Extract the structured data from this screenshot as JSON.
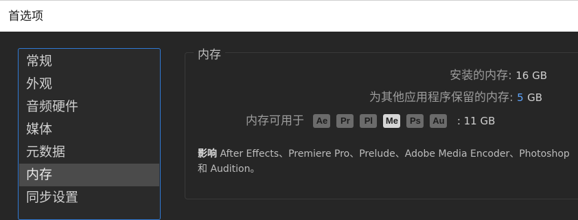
{
  "window": {
    "title": "首选项"
  },
  "sidebar": {
    "items": [
      {
        "label": "常规"
      },
      {
        "label": "外观"
      },
      {
        "label": "音频硬件"
      },
      {
        "label": "媒体"
      },
      {
        "label": "元数据"
      },
      {
        "label": "内存",
        "selected": true
      },
      {
        "label": "同步设置"
      }
    ]
  },
  "memory": {
    "section_title": "内存",
    "installed_label": "安装的内存:",
    "installed_value": "16 GB",
    "reserved_label": "为其他应用程序保留的内存:",
    "reserved_value": "5",
    "reserved_unit": "GB",
    "available_label": "内存可用于",
    "apps": [
      {
        "abbr": "Ae",
        "active": false
      },
      {
        "abbr": "Pr",
        "active": false
      },
      {
        "abbr": "Pl",
        "active": false
      },
      {
        "abbr": "Me",
        "active": true
      },
      {
        "abbr": "Ps",
        "active": false
      },
      {
        "abbr": "Au",
        "active": false
      }
    ],
    "available_value": ": 11 GB",
    "desc_prefix": "影响",
    "desc_text": "After Effects、Premiere Pro、Prelude、Adobe Media Encoder、Photoshop 和 Audition。"
  },
  "colors": {
    "accent": "#2f7ad6",
    "value_accent": "#5fa6ff",
    "selected_bg": "#4b4b4b"
  }
}
